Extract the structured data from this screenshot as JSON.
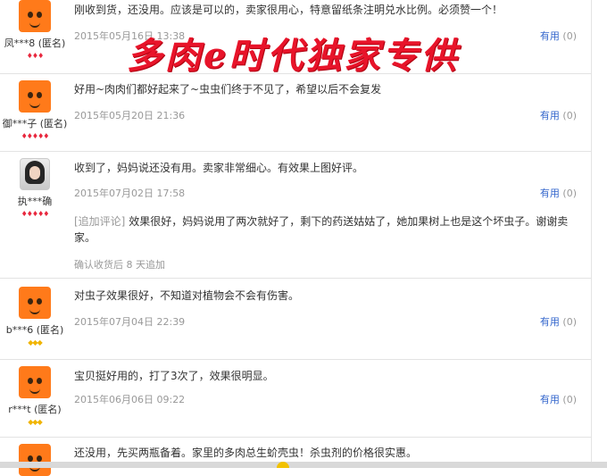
{
  "colors": {
    "link": "#3366cc",
    "meta": "#999999",
    "watermark": "#e8142a",
    "heart_rank": "#e8283e",
    "diamond_rank": "#f0b400"
  },
  "reviews": [
    {
      "user": "凤***8 (匿名)",
      "avatar": "mascot",
      "rank_icon": "heart",
      "rank_level": 3,
      "text": "刚收到货，还没用。应该是可以的，卖家很用心，特意留纸条注明兑水比例。必须赞一个！",
      "date": "2015年05月16日 13:38",
      "helpful_label": "有用",
      "helpful_count": "(0)"
    },
    {
      "user": "御***子 (匿名)",
      "avatar": "mascot",
      "rank_icon": "heart",
      "rank_level": 5,
      "text": "好用~肉肉们都好起来了~虫虫们终于不见了，希望以后不会复发",
      "date": "2015年05月20日 21:36",
      "helpful_label": "有用",
      "helpful_count": "(0)"
    },
    {
      "user": "执***确",
      "avatar": "photo",
      "rank_icon": "heart",
      "rank_level": 5,
      "text": "收到了，妈妈说还没有用。卖家非常细心。有效果上图好评。",
      "date": "2015年07月02日 17:58",
      "helpful_label": "有用",
      "helpful_count": "(0)",
      "append_tag": "[追加评论]",
      "append_text": "效果很好，妈妈说用了两次就好了，剩下的药送姑姑了，她加果树上也是这个坏虫子。谢谢卖家。",
      "append_meta": "确认收货后 8 天追加"
    },
    {
      "user": "b***6 (匿名)",
      "avatar": "mascot",
      "rank_icon": "diamond",
      "rank_level": 3,
      "text": "对虫子效果很好，不知道对植物会不会有伤害。",
      "date": "2015年07月04日 22:39",
      "helpful_label": "有用",
      "helpful_count": "(0)"
    },
    {
      "user": "r***t (匿名)",
      "avatar": "mascot",
      "rank_icon": "diamond",
      "rank_level": 3,
      "text": "宝贝挺好用的，打了3次了，效果很明显。",
      "date": "2015年06月06日 09:22",
      "helpful_label": "有用",
      "helpful_count": "(0)"
    },
    {
      "text": "还没用，先买两瓶备着。家里的多肉总生蚧壳虫！杀虫剂的价格很实惠。"
    }
  ],
  "watermark": "多肉e时代独家专供"
}
